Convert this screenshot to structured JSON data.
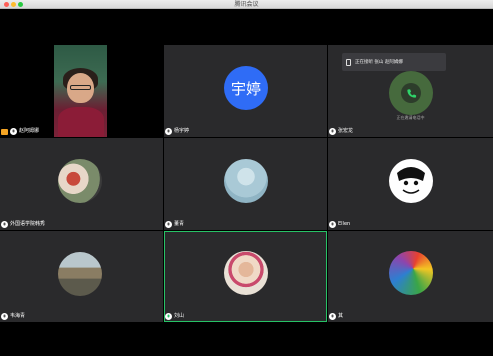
{
  "window": {
    "title": "腾讯会议"
  },
  "participants": [
    {
      "name": "赵阿姆娜",
      "mic": "muted",
      "sharing": true,
      "avatar": "video"
    },
    {
      "name": "杨宇婷",
      "mic": "muted",
      "avatar_text": "宇婷"
    },
    {
      "name": "张宏龙",
      "mic": "muted",
      "calling_text": "正在接听 张山 赵阿姆娜",
      "sub_status": "正在邀请电话中"
    },
    {
      "name": "外国语学院韩秀",
      "mic": "muted",
      "avatar": "photo-kids"
    },
    {
      "name": "董青",
      "mic": "muted",
      "avatar": "photo-water"
    },
    {
      "name": "Ellen",
      "mic": "muted",
      "avatar": "cartoon"
    },
    {
      "name": "韦海青",
      "mic": "muted",
      "avatar": "photo-house"
    },
    {
      "name": "刘山",
      "mic": "active",
      "avatar": "photo-baby"
    },
    {
      "name": "其",
      "mic": "muted",
      "avatar": "photo-umbrella"
    }
  ],
  "colors": {
    "active_speaker": "#27c266",
    "avatar_blue": "#2f6cf6"
  }
}
